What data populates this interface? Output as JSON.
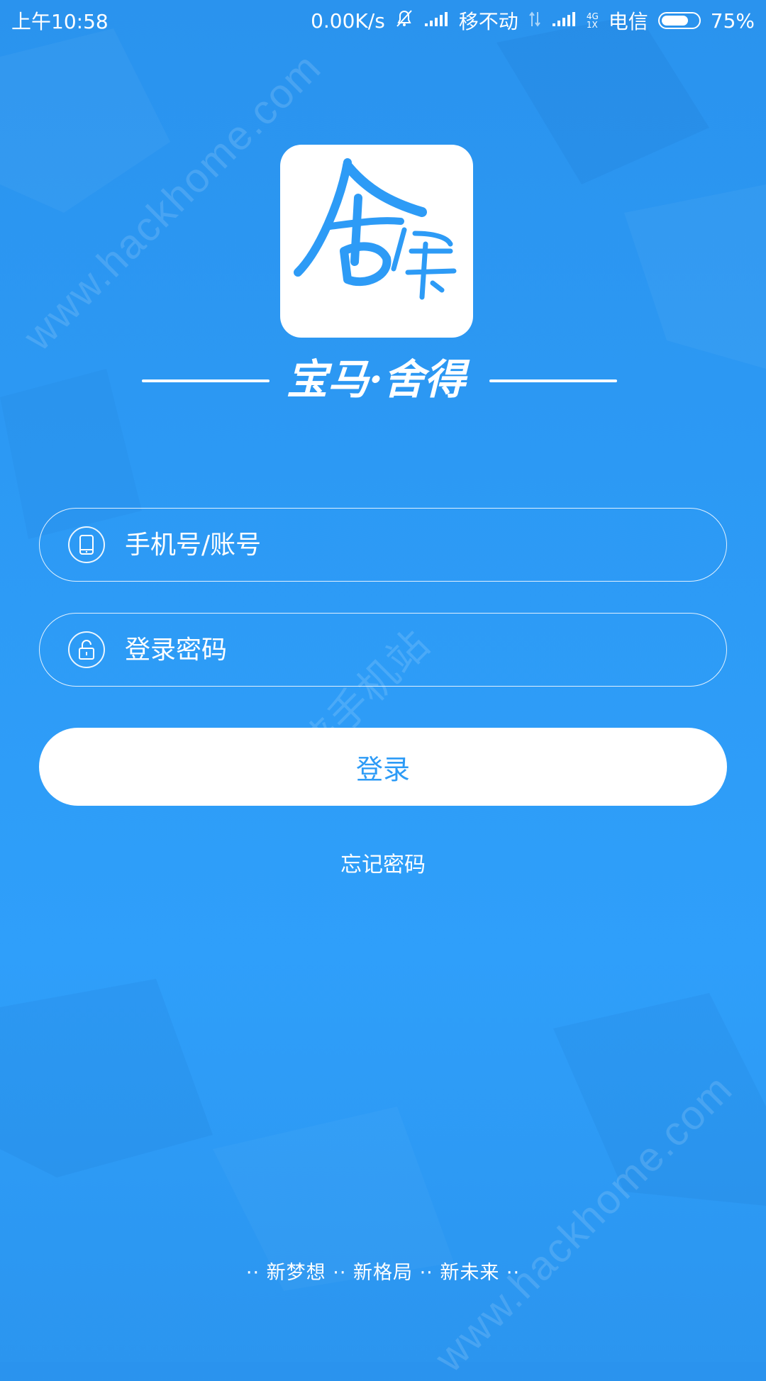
{
  "status_bar": {
    "time": "上午10:58",
    "net_speed": "0.00K/s",
    "carrier1": "移不动",
    "network_type_top": "4G",
    "network_type_bottom": "1X",
    "carrier2": "电信",
    "battery": "75%",
    "battery_level": 0.75
  },
  "logo": {
    "app_mark": "舍得",
    "slogan": "宝马·舍得"
  },
  "form": {
    "account_placeholder": "手机号/账号",
    "password_placeholder": "登录密码",
    "login_label": "登录",
    "forgot_label": "忘记密码"
  },
  "footer": {
    "slogan": "·· 新梦想 ·· 新格局 ·· 新未来 ··"
  },
  "watermarks": {
    "top": "www.hackhome.com",
    "middle": "侠手机站",
    "bottom": "www.hackhome.com"
  },
  "colors": {
    "background": "#2d9bf6",
    "accent": "#2d9bf6",
    "text": "#ffffff"
  }
}
